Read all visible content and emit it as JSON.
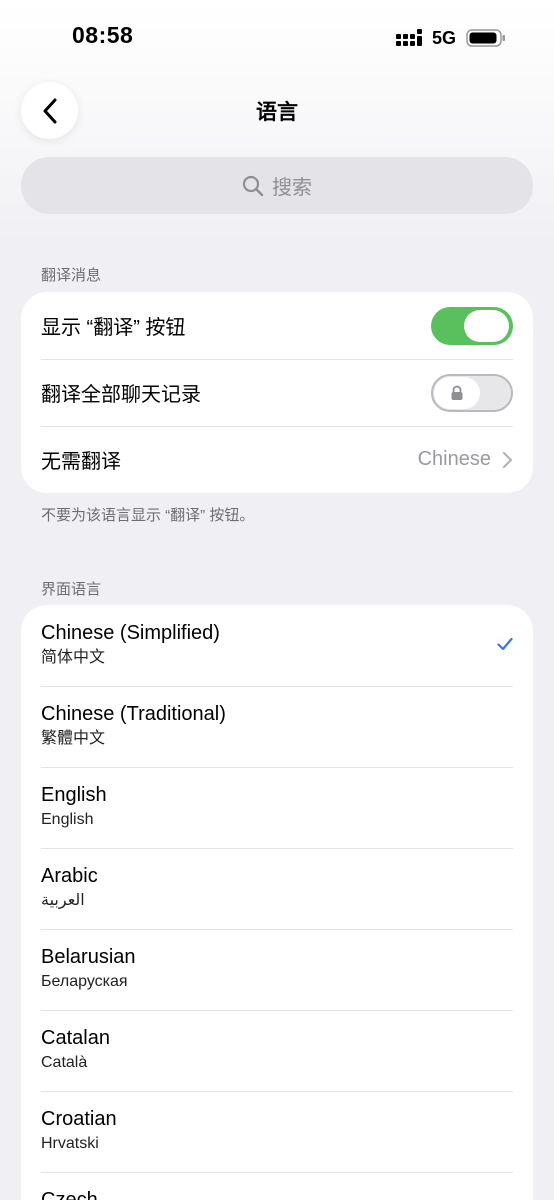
{
  "status_bar": {
    "time": "08:58",
    "network": "5G"
  },
  "nav": {
    "title": "语言",
    "back_icon": "chevron-left-icon"
  },
  "search": {
    "placeholder": "搜索",
    "icon": "search-icon"
  },
  "translate_section": {
    "header": "翻译消息",
    "rows": [
      {
        "label": "显示 “翻译” 按钮",
        "control": "toggle",
        "state": "on"
      },
      {
        "label": "翻译全部聊天记录",
        "control": "toggle",
        "state": "off-locked"
      },
      {
        "label": "无需翻译",
        "value": "Chinese",
        "control": "disclosure"
      }
    ],
    "footer": "不要为该语言显示 “翻译” 按钮。"
  },
  "interface_section": {
    "header": "界面语言",
    "languages": [
      {
        "name": "Chinese (Simplified)",
        "native": "简体中文",
        "selected": true
      },
      {
        "name": "Chinese (Traditional)",
        "native": "繁體中文",
        "selected": false
      },
      {
        "name": "English",
        "native": "English",
        "selected": false
      },
      {
        "name": "Arabic",
        "native": "العربية",
        "selected": false
      },
      {
        "name": "Belarusian",
        "native": "Беларуская",
        "selected": false
      },
      {
        "name": "Catalan",
        "native": "Català",
        "selected": false
      },
      {
        "name": "Croatian",
        "native": "Hrvatski",
        "selected": false
      },
      {
        "name": "Czech",
        "native": "",
        "selected": false
      }
    ]
  },
  "colors": {
    "toggle_on": "#5ac05e",
    "accent": "#3478f6",
    "background": "#efeff4"
  }
}
